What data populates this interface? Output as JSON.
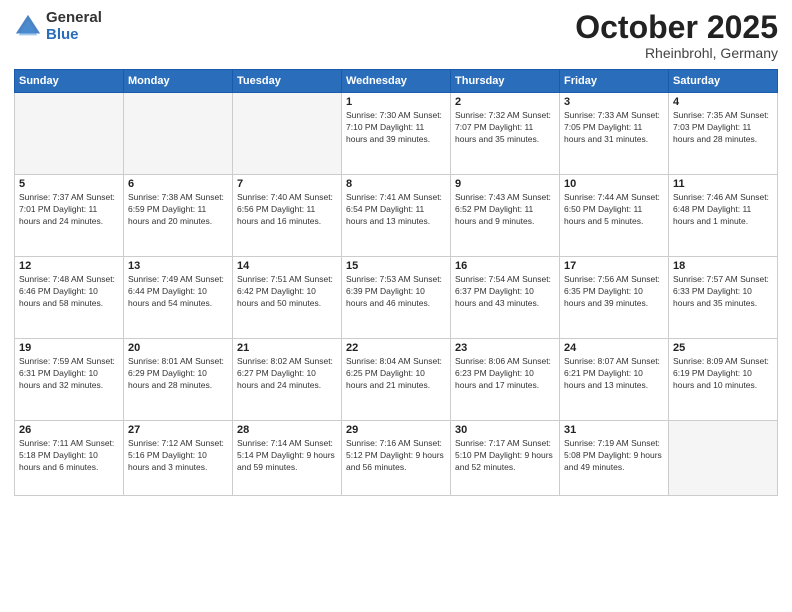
{
  "header": {
    "logo_general": "General",
    "logo_blue": "Blue",
    "month_title": "October 2025",
    "subtitle": "Rheinbrohl, Germany"
  },
  "weekdays": [
    "Sunday",
    "Monday",
    "Tuesday",
    "Wednesday",
    "Thursday",
    "Friday",
    "Saturday"
  ],
  "weeks": [
    [
      {
        "day": "",
        "info": ""
      },
      {
        "day": "",
        "info": ""
      },
      {
        "day": "",
        "info": ""
      },
      {
        "day": "1",
        "info": "Sunrise: 7:30 AM\nSunset: 7:10 PM\nDaylight: 11 hours\nand 39 minutes."
      },
      {
        "day": "2",
        "info": "Sunrise: 7:32 AM\nSunset: 7:07 PM\nDaylight: 11 hours\nand 35 minutes."
      },
      {
        "day": "3",
        "info": "Sunrise: 7:33 AM\nSunset: 7:05 PM\nDaylight: 11 hours\nand 31 minutes."
      },
      {
        "day": "4",
        "info": "Sunrise: 7:35 AM\nSunset: 7:03 PM\nDaylight: 11 hours\nand 28 minutes."
      }
    ],
    [
      {
        "day": "5",
        "info": "Sunrise: 7:37 AM\nSunset: 7:01 PM\nDaylight: 11 hours\nand 24 minutes."
      },
      {
        "day": "6",
        "info": "Sunrise: 7:38 AM\nSunset: 6:59 PM\nDaylight: 11 hours\nand 20 minutes."
      },
      {
        "day": "7",
        "info": "Sunrise: 7:40 AM\nSunset: 6:56 PM\nDaylight: 11 hours\nand 16 minutes."
      },
      {
        "day": "8",
        "info": "Sunrise: 7:41 AM\nSunset: 6:54 PM\nDaylight: 11 hours\nand 13 minutes."
      },
      {
        "day": "9",
        "info": "Sunrise: 7:43 AM\nSunset: 6:52 PM\nDaylight: 11 hours\nand 9 minutes."
      },
      {
        "day": "10",
        "info": "Sunrise: 7:44 AM\nSunset: 6:50 PM\nDaylight: 11 hours\nand 5 minutes."
      },
      {
        "day": "11",
        "info": "Sunrise: 7:46 AM\nSunset: 6:48 PM\nDaylight: 11 hours\nand 1 minute."
      }
    ],
    [
      {
        "day": "12",
        "info": "Sunrise: 7:48 AM\nSunset: 6:46 PM\nDaylight: 10 hours\nand 58 minutes."
      },
      {
        "day": "13",
        "info": "Sunrise: 7:49 AM\nSunset: 6:44 PM\nDaylight: 10 hours\nand 54 minutes."
      },
      {
        "day": "14",
        "info": "Sunrise: 7:51 AM\nSunset: 6:42 PM\nDaylight: 10 hours\nand 50 minutes."
      },
      {
        "day": "15",
        "info": "Sunrise: 7:53 AM\nSunset: 6:39 PM\nDaylight: 10 hours\nand 46 minutes."
      },
      {
        "day": "16",
        "info": "Sunrise: 7:54 AM\nSunset: 6:37 PM\nDaylight: 10 hours\nand 43 minutes."
      },
      {
        "day": "17",
        "info": "Sunrise: 7:56 AM\nSunset: 6:35 PM\nDaylight: 10 hours\nand 39 minutes."
      },
      {
        "day": "18",
        "info": "Sunrise: 7:57 AM\nSunset: 6:33 PM\nDaylight: 10 hours\nand 35 minutes."
      }
    ],
    [
      {
        "day": "19",
        "info": "Sunrise: 7:59 AM\nSunset: 6:31 PM\nDaylight: 10 hours\nand 32 minutes."
      },
      {
        "day": "20",
        "info": "Sunrise: 8:01 AM\nSunset: 6:29 PM\nDaylight: 10 hours\nand 28 minutes."
      },
      {
        "day": "21",
        "info": "Sunrise: 8:02 AM\nSunset: 6:27 PM\nDaylight: 10 hours\nand 24 minutes."
      },
      {
        "day": "22",
        "info": "Sunrise: 8:04 AM\nSunset: 6:25 PM\nDaylight: 10 hours\nand 21 minutes."
      },
      {
        "day": "23",
        "info": "Sunrise: 8:06 AM\nSunset: 6:23 PM\nDaylight: 10 hours\nand 17 minutes."
      },
      {
        "day": "24",
        "info": "Sunrise: 8:07 AM\nSunset: 6:21 PM\nDaylight: 10 hours\nand 13 minutes."
      },
      {
        "day": "25",
        "info": "Sunrise: 8:09 AM\nSunset: 6:19 PM\nDaylight: 10 hours\nand 10 minutes."
      }
    ],
    [
      {
        "day": "26",
        "info": "Sunrise: 7:11 AM\nSunset: 5:18 PM\nDaylight: 10 hours\nand 6 minutes."
      },
      {
        "day": "27",
        "info": "Sunrise: 7:12 AM\nSunset: 5:16 PM\nDaylight: 10 hours\nand 3 minutes."
      },
      {
        "day": "28",
        "info": "Sunrise: 7:14 AM\nSunset: 5:14 PM\nDaylight: 9 hours\nand 59 minutes."
      },
      {
        "day": "29",
        "info": "Sunrise: 7:16 AM\nSunset: 5:12 PM\nDaylight: 9 hours\nand 56 minutes."
      },
      {
        "day": "30",
        "info": "Sunrise: 7:17 AM\nSunset: 5:10 PM\nDaylight: 9 hours\nand 52 minutes."
      },
      {
        "day": "31",
        "info": "Sunrise: 7:19 AM\nSunset: 5:08 PM\nDaylight: 9 hours\nand 49 minutes."
      },
      {
        "day": "",
        "info": ""
      }
    ]
  ]
}
